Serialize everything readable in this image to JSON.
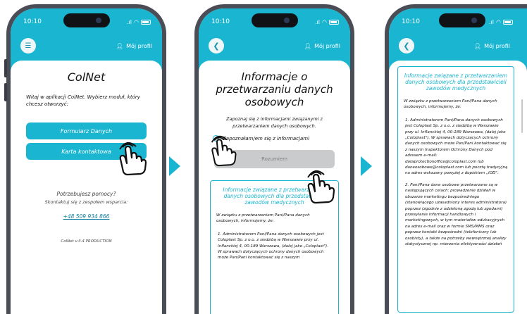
{
  "status": {
    "time": "10:10"
  },
  "nav": {
    "profile_label": "Mój profil"
  },
  "screen1": {
    "title": "ColNet",
    "intro": "Witaj w aplikacji ColNet. Wybierz moduł, który chcesz otworzyć:",
    "btn_forms": "Formularz Danych",
    "btn_contact": "Karta kontaktowa",
    "help_heading": "Potrzebujesz pomocy?",
    "help_text": "Skontaktuj się z zespołem wsparcia:",
    "help_phone": "+48 509 934 866",
    "version": "ColNet v.3.4 PRODUCTION"
  },
  "screen2": {
    "title": "Informacje o przetwarzaniu danych osobowych",
    "intro": "Zapoznaj się z informacjami związanymi z przetwarzaniem danych osobowych.",
    "checkbox_label": "Zapoznałam/em się z informacjami",
    "btn_understand": "Rozumiem",
    "box_title": "Informacje związane z przetwarzaniem danych osobowych dla przedstawicieli zawodów medycznych",
    "box_intro": "W związku z przetwarzaniem Pani/Pana danych osobowych, informujemy, że:",
    "box_p1": "1. Administratorem Pani/Pana danych osobowych jest Coloplast Sp. z o.o. z siedzibą w Warszawie przy ul. Inflanckiej 4, 00-189 Warszawa, (dalej jako „Coloplast\"). W sprawach dotyczących ochrony danych osobowych może Pan/Pani kontaktować się z naszym"
  },
  "screen3": {
    "box_title": "Informacje związane z przetwarzaniem danych osobowych dla przedstawicieli zawodów medycznych",
    "box_intro": "W związku z przetwarzaniem Pani/Pana danych osobowych, informujemy, że:",
    "box_p1": "1. Administratorem Pani/Pana danych osobowych jest Coloplast Sp. z o.o. z siedzibą w Warszawie przy ul. Inflanckiej 4, 00-189 Warszawa, (dalej jako „Coloplast\"). W sprawach dotyczących ochrony danych osobowych może Pan/Pani kontaktować się z naszym Inspektorem Ochrony Danych pod adresem e-mail: dataprotectionoffice@coloplast.com lub daneosobowe@coloplast.com lub pocztą tradycyjną na adres wskazany powyżej z dopiskiem „IOD\".",
    "box_p2": "2. Pani/Pana dane osobowe przetwarzane są w następujących celach: prowadzenie działań w obszarze marketingu bezpośredniego (stanowiącego uzasadniony interes administratora) poprzez (zgodnie z udzieloną zgodą lub zgodami) przesyłanie informacji handlowych i marketingowych, w tym materiałów edukacyjnych na adres e-mail oraz w formie SMS/MMS oraz poprzez kontakt bezpośredni (telefoniczny lub osobisty), a także na potrzeby wewnętrznej analizy statystycznej np. mierzenia efektywności działań"
  },
  "colors": {
    "accent": "#1ab6d1",
    "frame": "#4a4d55",
    "disabled": "#c9cbcd"
  }
}
